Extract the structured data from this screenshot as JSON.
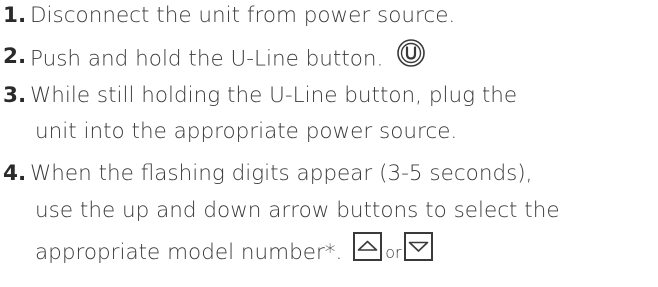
{
  "steps": [
    {
      "number": "1.",
      "lines": [
        "Disconnect the unit from power source."
      ]
    },
    {
      "number": "2.",
      "lines": [
        "Push and hold the U-Line button."
      ],
      "icon": "u-line-button-icon"
    },
    {
      "number": "3.",
      "lines": [
        "While still holding the U-Line button, plug the",
        "unit into the appropriate power source."
      ]
    },
    {
      "number": "4.",
      "lines": [
        "When the flashing digits appear (3-5 seconds),",
        "use the up and down arrow buttons to select the",
        "appropriate model number*."
      ],
      "connector": "or",
      "icons": [
        "up-arrow-button-icon",
        "down-arrow-button-icon"
      ]
    }
  ],
  "colors": {
    "text": "#3a3a3a",
    "number": "#2a2a2a",
    "icon_stroke": "#3a3a3a"
  }
}
